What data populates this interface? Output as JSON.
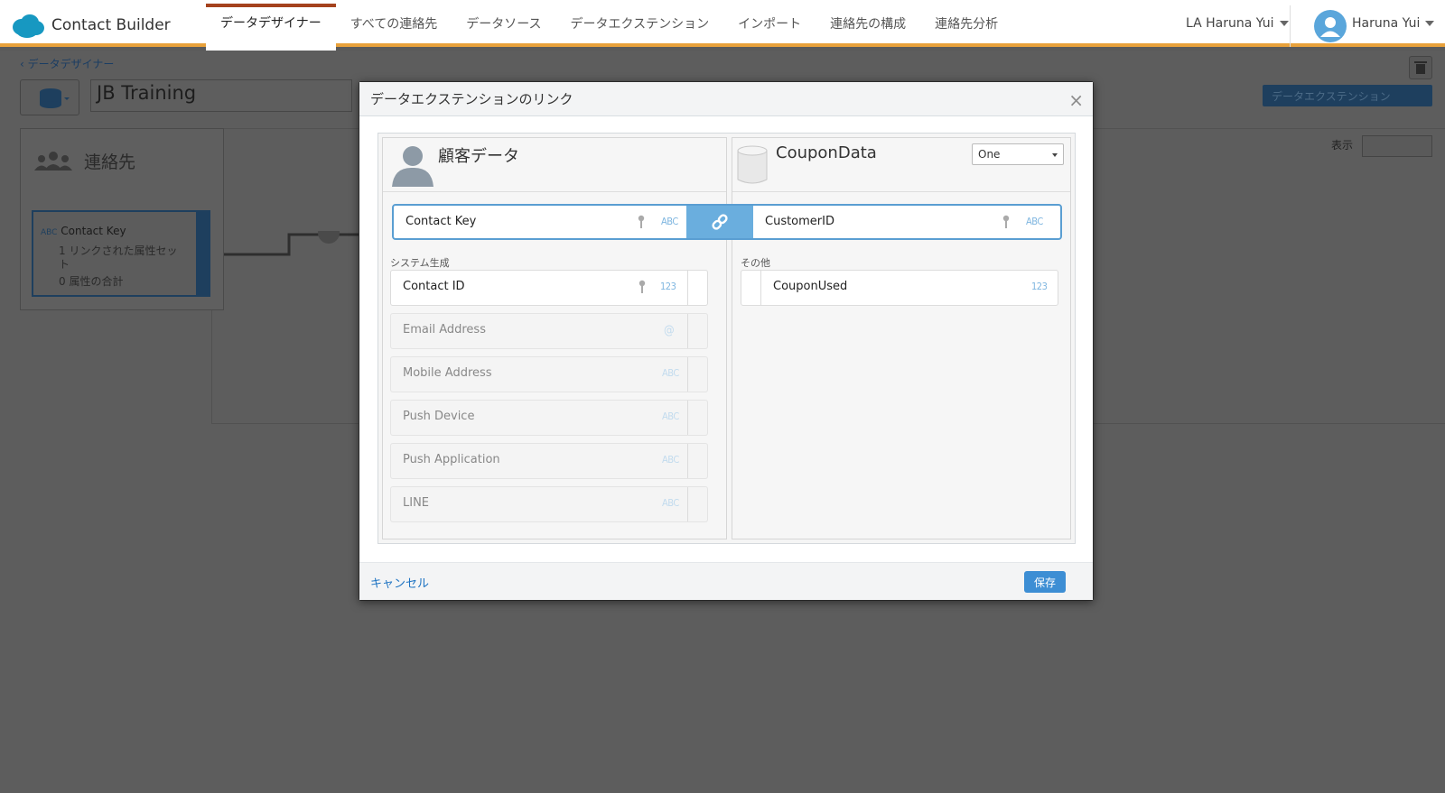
{
  "app": {
    "title": "Contact Builder"
  },
  "nav": {
    "tabs": [
      {
        "label": "データデザイナー",
        "active": true
      },
      {
        "label": "すべての連絡先"
      },
      {
        "label": "データソース"
      },
      {
        "label": "データエクステンション"
      },
      {
        "label": "インポート"
      },
      {
        "label": "連絡先の構成"
      },
      {
        "label": "連絡先分析"
      }
    ],
    "business_unit": "LA Haruna Yui",
    "user_name": "Haruna Yui"
  },
  "page": {
    "breadcrumb": "データデザイナー",
    "attribute_group_name": "JB Training",
    "data_extension_button": "データエクステンション",
    "view_label": "表示"
  },
  "canvas": {
    "contacts_title": "連絡先",
    "attribute": {
      "type_icon": "ABC",
      "name": "Contact Key",
      "linked_sets": "1 リンクされた属性セット",
      "total_attributes": "0 属性の合計"
    }
  },
  "modal": {
    "title": "データエクステンションのリンク",
    "left": {
      "name": "顧客データ",
      "link_field": {
        "label": "Contact Key",
        "type": "ABC"
      },
      "section_label": "システム生成",
      "fields": [
        {
          "label": "Contact ID",
          "type": "123",
          "key": true
        },
        {
          "label": "Email Address",
          "type": "@"
        },
        {
          "label": "Mobile Address",
          "type": "ABC"
        },
        {
          "label": "Push Device",
          "type": "ABC"
        },
        {
          "label": "Push Application",
          "type": "ABC"
        },
        {
          "label": "LINE",
          "type": "ABC"
        }
      ]
    },
    "right": {
      "name": "CouponData",
      "cardinality": "One",
      "link_field": {
        "label": "CustomerID",
        "type": "ABC"
      },
      "section_label": "その他",
      "fields": [
        {
          "label": "CouponUsed",
          "type": "123"
        }
      ]
    },
    "cancel_label": "キャンセル",
    "save_label": "保存"
  },
  "colors": {
    "accent_orange": "#e8a13a",
    "active_tab_top": "#a5421d",
    "link_blue": "#5a9ed2",
    "save_blue": "#3d8ed4"
  }
}
